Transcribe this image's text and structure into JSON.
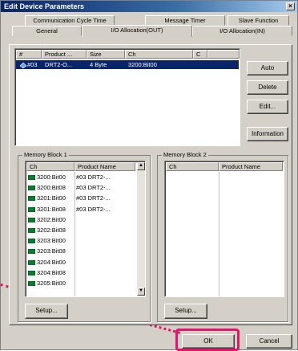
{
  "window": {
    "title": "Edit Device Parameters",
    "close_glyph": "×"
  },
  "tabs_back": [
    {
      "label": "Communication Cycle Time"
    },
    {
      "label": "Message Timer"
    },
    {
      "label": "Slave Function"
    }
  ],
  "tabs_front": [
    {
      "label": "General"
    },
    {
      "label": "I/O Allocation(OUT)",
      "active": true
    },
    {
      "label": "I/O Allocation(IN)"
    }
  ],
  "device_list": {
    "columns": [
      "#",
      "Product ...",
      "Size",
      "Ch",
      "C"
    ],
    "rows": [
      {
        "num": "#03",
        "product": "DRT2-O...",
        "size": "4 Byte",
        "ch": "3200:Bit00",
        "selected": true
      }
    ]
  },
  "side_buttons": {
    "auto": "Auto",
    "delete": "Delete",
    "edit": "Edit...",
    "information": "Information"
  },
  "memory_block_1": {
    "label": "Memory Block 1",
    "columns": [
      "Ch",
      "Product Name"
    ],
    "rows": [
      {
        "ch": "3200:Bit00",
        "product": "#03 DRT2-..."
      },
      {
        "ch": "3200:Bit08",
        "product": "#03 DRT2-..."
      },
      {
        "ch": "3201:Bit00",
        "product": "#03 DRT2-..."
      },
      {
        "ch": "3201:Bit08",
        "product": "#03 DRT2-..."
      },
      {
        "ch": "3202:Bit00",
        "product": ""
      },
      {
        "ch": "3202:Bit08",
        "product": ""
      },
      {
        "ch": "3203:Bit00",
        "product": ""
      },
      {
        "ch": "3203:Bit08",
        "product": ""
      },
      {
        "ch": "3204:Bit00",
        "product": ""
      },
      {
        "ch": "3204:Bit08",
        "product": ""
      },
      {
        "ch": "3205:Bit00",
        "product": ""
      }
    ],
    "setup_label": "Setup..."
  },
  "memory_block_2": {
    "label": "Memory Block 2",
    "columns": [
      "Ch",
      "Product Name"
    ],
    "setup_label": "Setup..."
  },
  "footer": {
    "ok": "OK",
    "cancel": "Cancel"
  },
  "colors": {
    "highlight": "#e0166e",
    "selection": "#0a246a",
    "chip": "#0f7a2a"
  }
}
